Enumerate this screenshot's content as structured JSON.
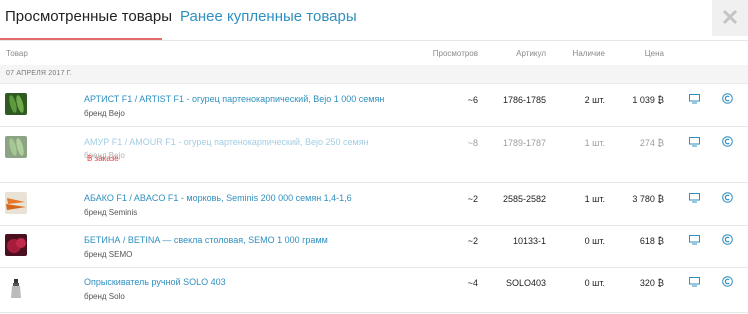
{
  "tabs": {
    "viewed_label": "Просмотренные товары",
    "bought_label": "Ранее купленные товары"
  },
  "columns": {
    "product": "Товар",
    "views": "Просмотров",
    "sku": "Артикул",
    "stock": "Наличие",
    "price": "Цена"
  },
  "date_group": "07 АПРЕЛЯ 2017 Г.",
  "colors": {
    "accent": "#2f8fbf",
    "tab_underline": "#e46b6b",
    "order_status": "#e04545"
  },
  "rows": [
    {
      "name": "АРТИСТ F1 / ARTIST F1 - огурец партенокарпический, Bejo 1 000 семян",
      "brand": "бренд Bejo",
      "views": "~6",
      "sku": "1786-1785",
      "stock": "2 шт.",
      "price": "1 039 ₿",
      "thumb": "cucumber-image"
    },
    {
      "name": "АМУР F1 / AMOUR F1 - огурец партенокарпический, Bejo 250 семян",
      "brand": "бренд Bejo",
      "status": "В заказе",
      "views": "~8",
      "sku": "1789-1787",
      "stock": "1 шт.",
      "price": "274 ₿",
      "thumb": "cucumber-image"
    },
    {
      "name": "АБАКО F1 / ABACO F1 - морковь, Seminis 200 000 семян 1,4-1,6",
      "brand": "бренд Seminis",
      "views": "~2",
      "sku": "2585-2582",
      "stock": "1 шт.",
      "price": "3 780 ₿",
      "thumb": "carrot-image"
    },
    {
      "name": "БЕТИНА / BETINA — свекла столовая, SEMO 1 000 грамм",
      "brand": "бренд SEMO",
      "views": "~2",
      "sku": "10133-1",
      "stock": "0 шт.",
      "price": "618 ₿",
      "thumb": "beet-image"
    },
    {
      "name": "Опрыскиватель ручной SOLO 403",
      "brand": "бренд Solo",
      "views": "~4",
      "sku": "SOLO403",
      "stock": "0 шт.",
      "price": "320 ₿",
      "thumb": "sprayer-image"
    }
  ]
}
